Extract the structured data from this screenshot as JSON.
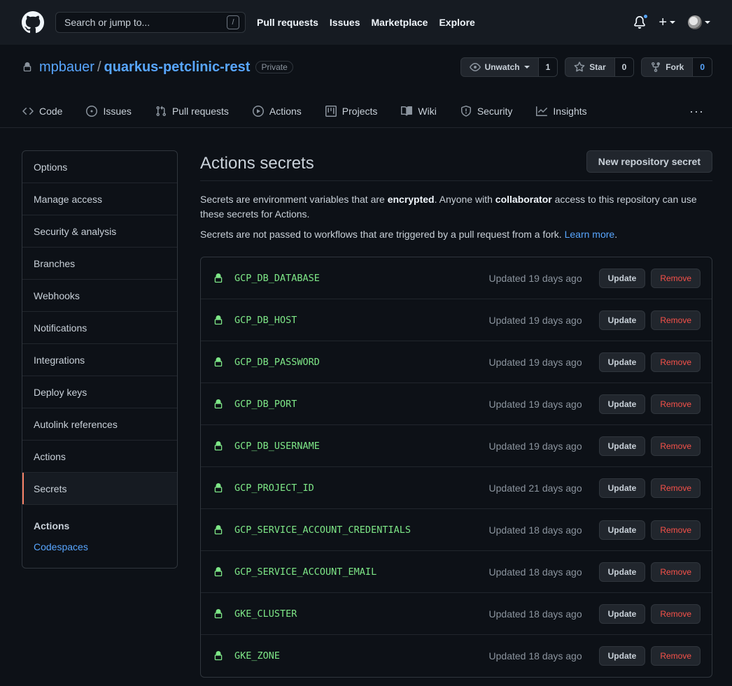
{
  "header": {
    "search_placeholder": "Search or jump to...",
    "search_shortcut": "/",
    "nav": [
      "Pull requests",
      "Issues",
      "Marketplace",
      "Explore"
    ],
    "plus_label": "+"
  },
  "repo": {
    "owner": "mpbauer",
    "separator": "/",
    "name": "quarkus-petclinic-rest",
    "visibility": "Private",
    "watch_label": "Unwatch",
    "watch_count": "1",
    "star_label": "Star",
    "star_count": "0",
    "fork_label": "Fork",
    "fork_count": "0"
  },
  "tabs": {
    "code": "Code",
    "issues": "Issues",
    "pulls": "Pull requests",
    "actions": "Actions",
    "projects": "Projects",
    "wiki": "Wiki",
    "security": "Security",
    "insights": "Insights",
    "more": "···"
  },
  "sidebar": {
    "items": [
      "Options",
      "Manage access",
      "Security & analysis",
      "Branches",
      "Webhooks",
      "Notifications",
      "Integrations",
      "Deploy keys",
      "Autolink references",
      "Actions",
      "Secrets"
    ],
    "section_head": "Actions",
    "section_link": "Codespaces"
  },
  "main": {
    "title": "Actions secrets",
    "new_button": "New repository secret",
    "desc_1a": "Secrets are environment variables that are ",
    "desc_1b": "encrypted",
    "desc_1c": ". Anyone with ",
    "desc_1d": "collaborator",
    "desc_1e": " access to this repository can use these secrets for Actions.",
    "desc_2a": "Secrets are not passed to workflows that are triggered by a pull request from a fork. ",
    "desc_2_link": "Learn more",
    "desc_2b": ".",
    "update_label": "Update",
    "remove_label": "Remove"
  },
  "secrets": [
    {
      "name": "GCP_DB_DATABASE",
      "updated": "Updated 19 days ago"
    },
    {
      "name": "GCP_DB_HOST",
      "updated": "Updated 19 days ago"
    },
    {
      "name": "GCP_DB_PASSWORD",
      "updated": "Updated 19 days ago"
    },
    {
      "name": "GCP_DB_PORT",
      "updated": "Updated 19 days ago"
    },
    {
      "name": "GCP_DB_USERNAME",
      "updated": "Updated 19 days ago"
    },
    {
      "name": "GCP_PROJECT_ID",
      "updated": "Updated 21 days ago"
    },
    {
      "name": "GCP_SERVICE_ACCOUNT_CREDENTIALS",
      "updated": "Updated 18 days ago"
    },
    {
      "name": "GCP_SERVICE_ACCOUNT_EMAIL",
      "updated": "Updated 18 days ago"
    },
    {
      "name": "GKE_CLUSTER",
      "updated": "Updated 18 days ago"
    },
    {
      "name": "GKE_ZONE",
      "updated": "Updated 18 days ago"
    }
  ],
  "colors": {
    "background": "#0d1117",
    "header": "#161b22",
    "accent_link": "#58a6ff",
    "secret_name": "#7ee787",
    "remove": "#f85149",
    "selected_marker": "#f78166"
  }
}
